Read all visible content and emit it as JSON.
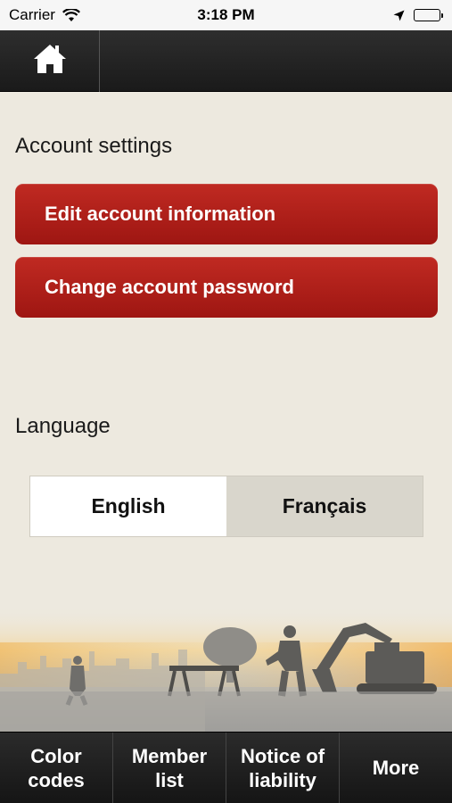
{
  "status_bar": {
    "carrier": "Carrier",
    "time": "3:18 PM"
  },
  "top_bar": {
    "home_icon": "home-icon"
  },
  "account": {
    "title": "Account settings",
    "edit_label": "Edit account information",
    "password_label": "Change account password"
  },
  "language": {
    "title": "Language",
    "options": [
      "English",
      "Français"
    ],
    "selected": "English"
  },
  "tabs": [
    {
      "label_line1": "Color",
      "label_line2": "codes"
    },
    {
      "label_line1": "Member",
      "label_line2": "list"
    },
    {
      "label_line1": "Notice of",
      "label_line2": "liability"
    },
    {
      "label_line1": "More",
      "label_line2": ""
    }
  ],
  "colors": {
    "accent_red": "#b21f19",
    "background": "#ede9df",
    "bar_dark": "#1f1f1f"
  }
}
